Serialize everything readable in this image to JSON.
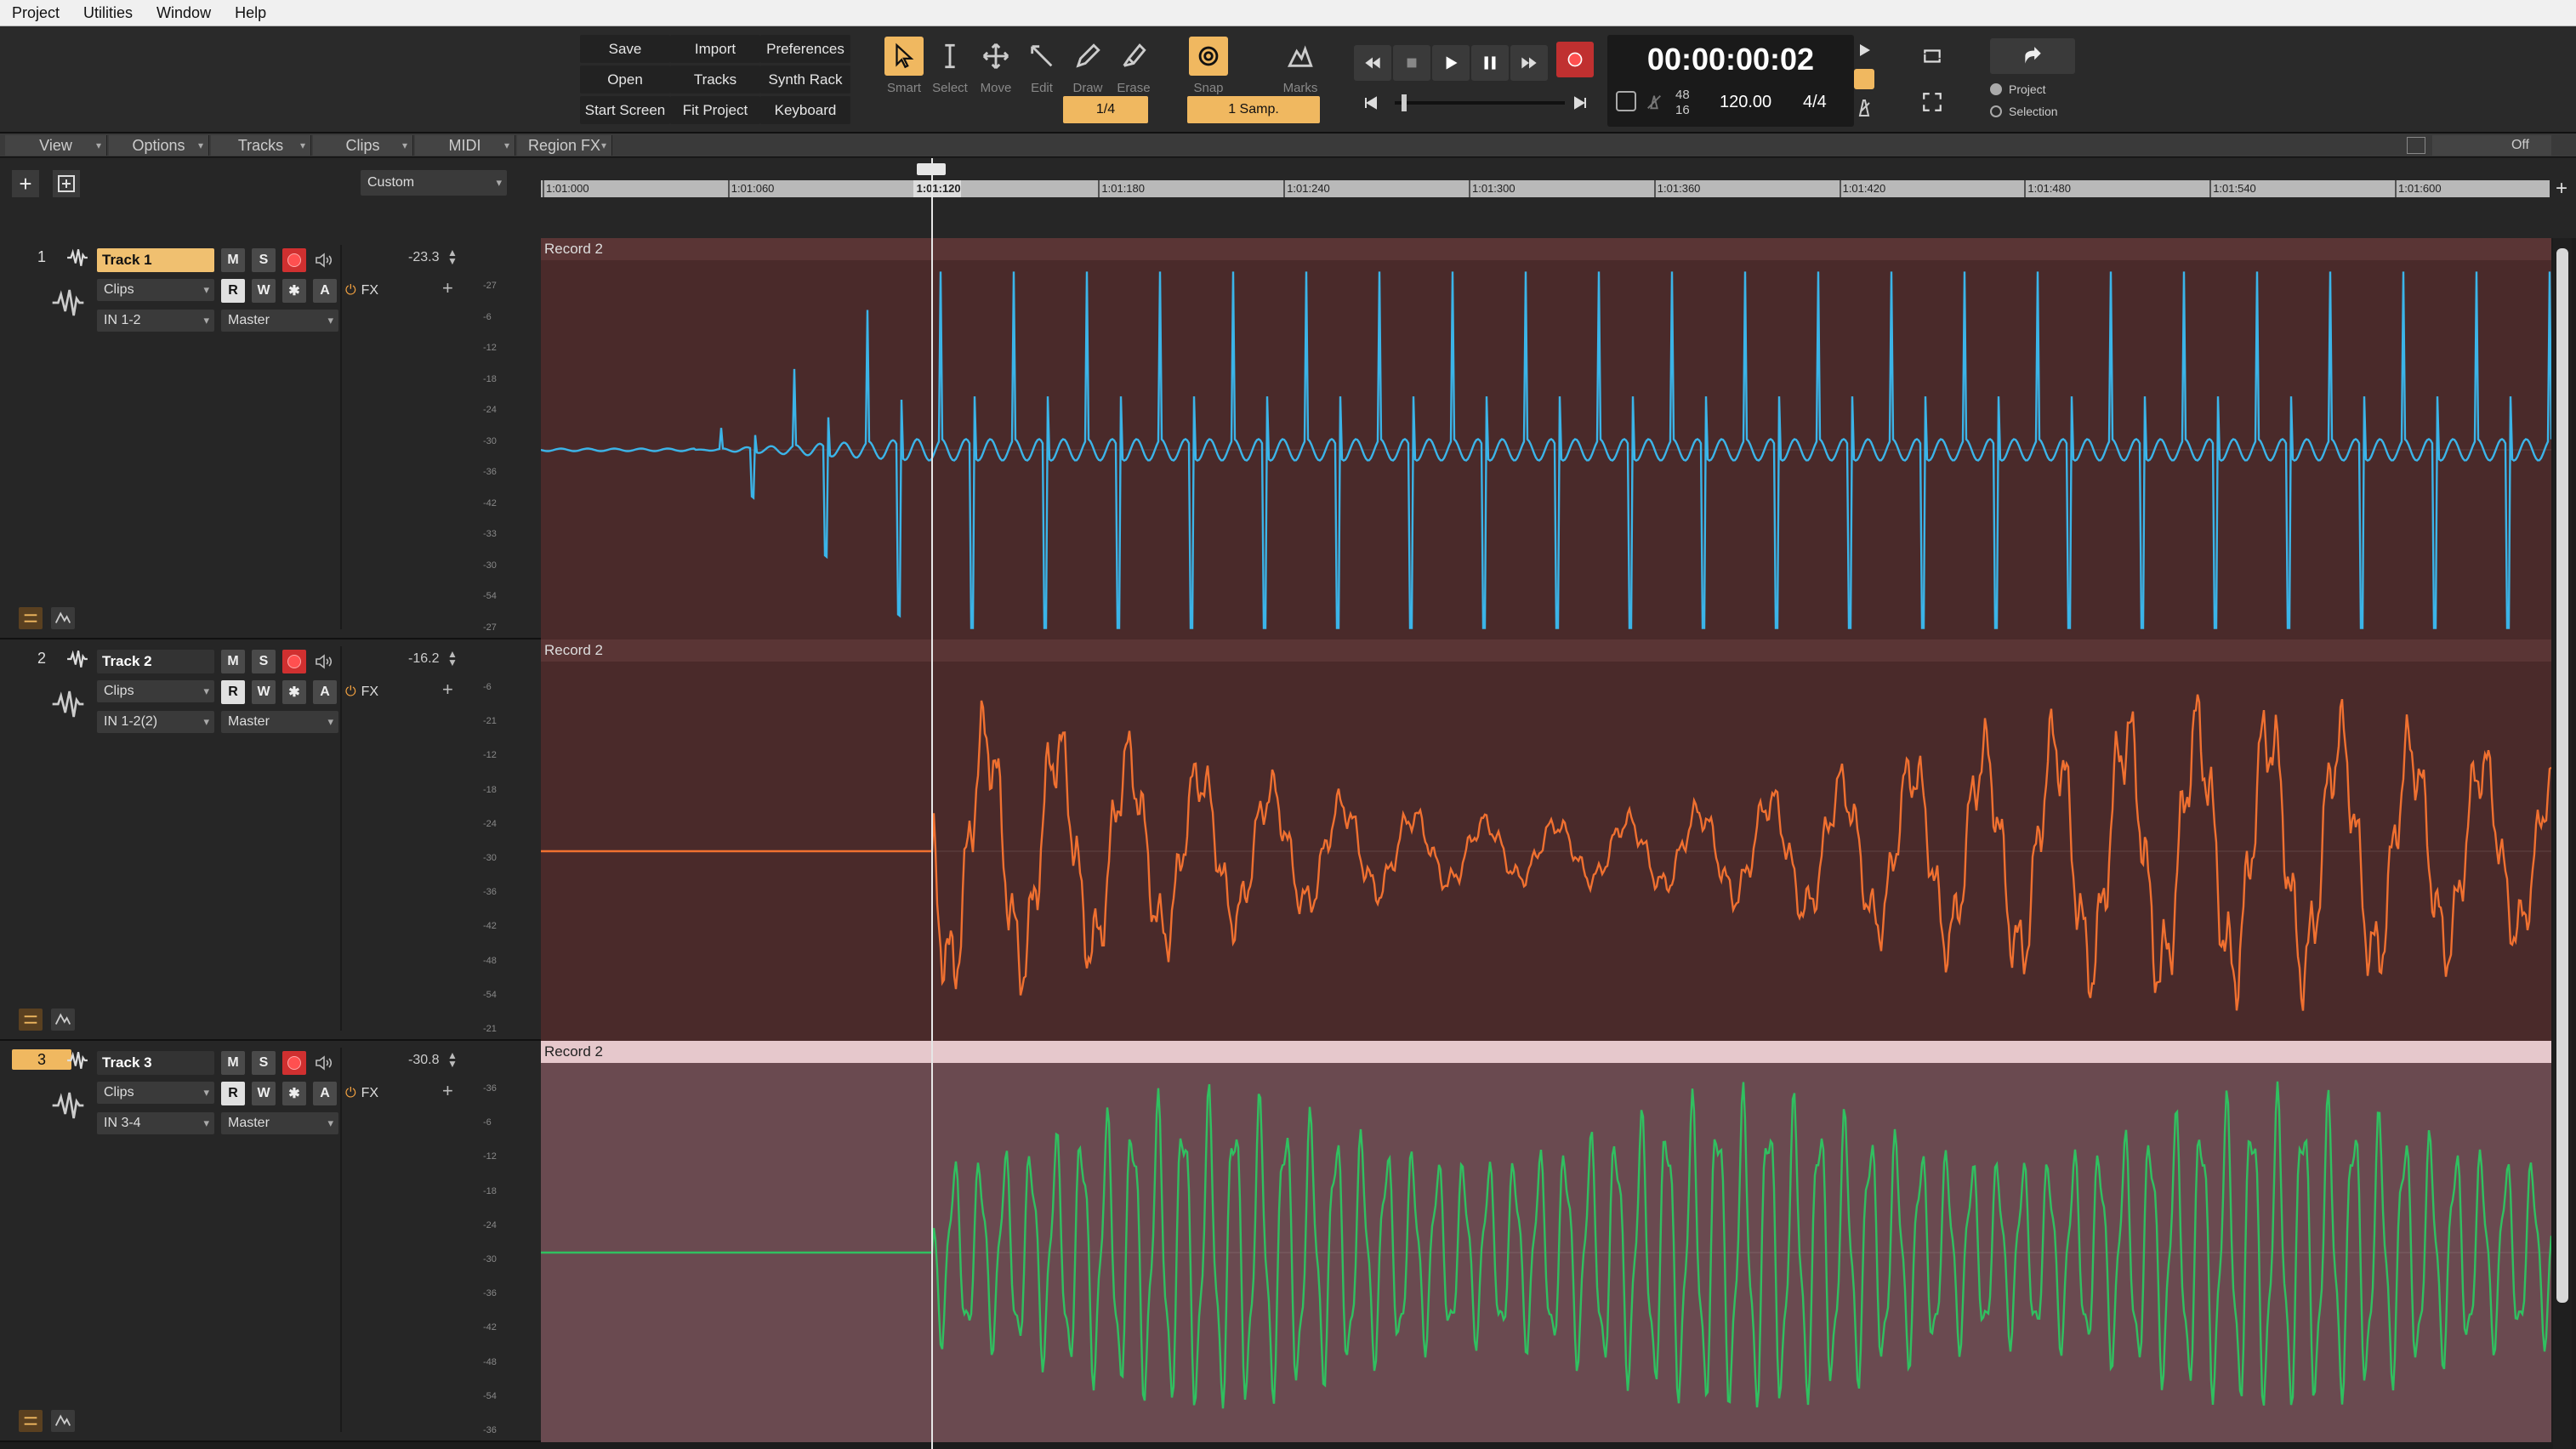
{
  "menu": [
    "Project",
    "Utilities",
    "Window",
    "Help"
  ],
  "control_buttons": {
    "save": "Save",
    "import": "Import",
    "preferences": "Preferences",
    "open": "Open",
    "tracks": "Tracks",
    "synth_rack": "Synth Rack",
    "start_screen": "Start Screen",
    "fit_project": "Fit Project",
    "keyboard": "Keyboard"
  },
  "tools": {
    "smart": "Smart",
    "select": "Select",
    "move": "Move",
    "edit": "Edit",
    "draw": "Draw",
    "erase": "Erase",
    "snap": "Snap",
    "marks": "Marks"
  },
  "snap": {
    "resolution": "1/4",
    "mode": "1 Samp."
  },
  "transport": {
    "time": "00:00:00:02",
    "sample_rate_top": "48",
    "sample_rate_bottom": "16",
    "tempo": "120.00",
    "meter": "4/4"
  },
  "range": {
    "project": "Project",
    "selection": "Selection"
  },
  "view_bar": [
    "View",
    "Options",
    "Tracks",
    "Clips",
    "MIDI",
    "Region FX"
  ],
  "view_bar_right": "Off",
  "track_view_preset": "Custom",
  "ruler": {
    "labels": [
      "1:01:000",
      "1:01:060",
      "1:01:120",
      "1:01:180",
      "1:01:240",
      "1:01:300",
      "1:01:360",
      "1:01:420",
      "1:01:480",
      "1:01:540",
      "1:01:600"
    ],
    "current": "1:01:120"
  },
  "tracks": [
    {
      "number": "1",
      "name": "Track 1",
      "volume": "-23.3",
      "view": "Clips",
      "input": "IN 1-2",
      "output": "Master",
      "fx": "FX",
      "clip_name": "Record 2",
      "color": "#3bb4e8",
      "scale": [
        "-27",
        "-6",
        "-12",
        "-18",
        "-24",
        "-30",
        "-36",
        "-42",
        "-33",
        "-30",
        "-54",
        "-27"
      ]
    },
    {
      "number": "2",
      "name": "Track 2",
      "volume": "-16.2",
      "view": "Clips",
      "input": "IN 1-2(2)",
      "output": "Master",
      "fx": "FX",
      "clip_name": "Record 2",
      "color": "#f07030",
      "scale": [
        "-6",
        "-21",
        "-12",
        "-18",
        "-24",
        "-30",
        "-36",
        "-42",
        "-48",
        "-54",
        "-21"
      ]
    },
    {
      "number": "3",
      "name": "Track 3",
      "volume": "-30.8",
      "view": "Clips",
      "input": "IN 3-4",
      "output": "Master",
      "fx": "FX",
      "clip_name": "Record 2",
      "color": "#30c060",
      "scale": [
        "-36",
        "-6",
        "-12",
        "-18",
        "-24",
        "-30",
        "-36",
        "-42",
        "-48",
        "-54",
        "-36"
      ]
    }
  ],
  "track_buttons": {
    "mute": "M",
    "solo": "S",
    "read": "R",
    "write": "W",
    "arm": "A"
  },
  "icons": {
    "add_track": "plus-icon",
    "track_icon": "waveform-icon",
    "loop": "loop-icon",
    "export": "export-icon"
  }
}
